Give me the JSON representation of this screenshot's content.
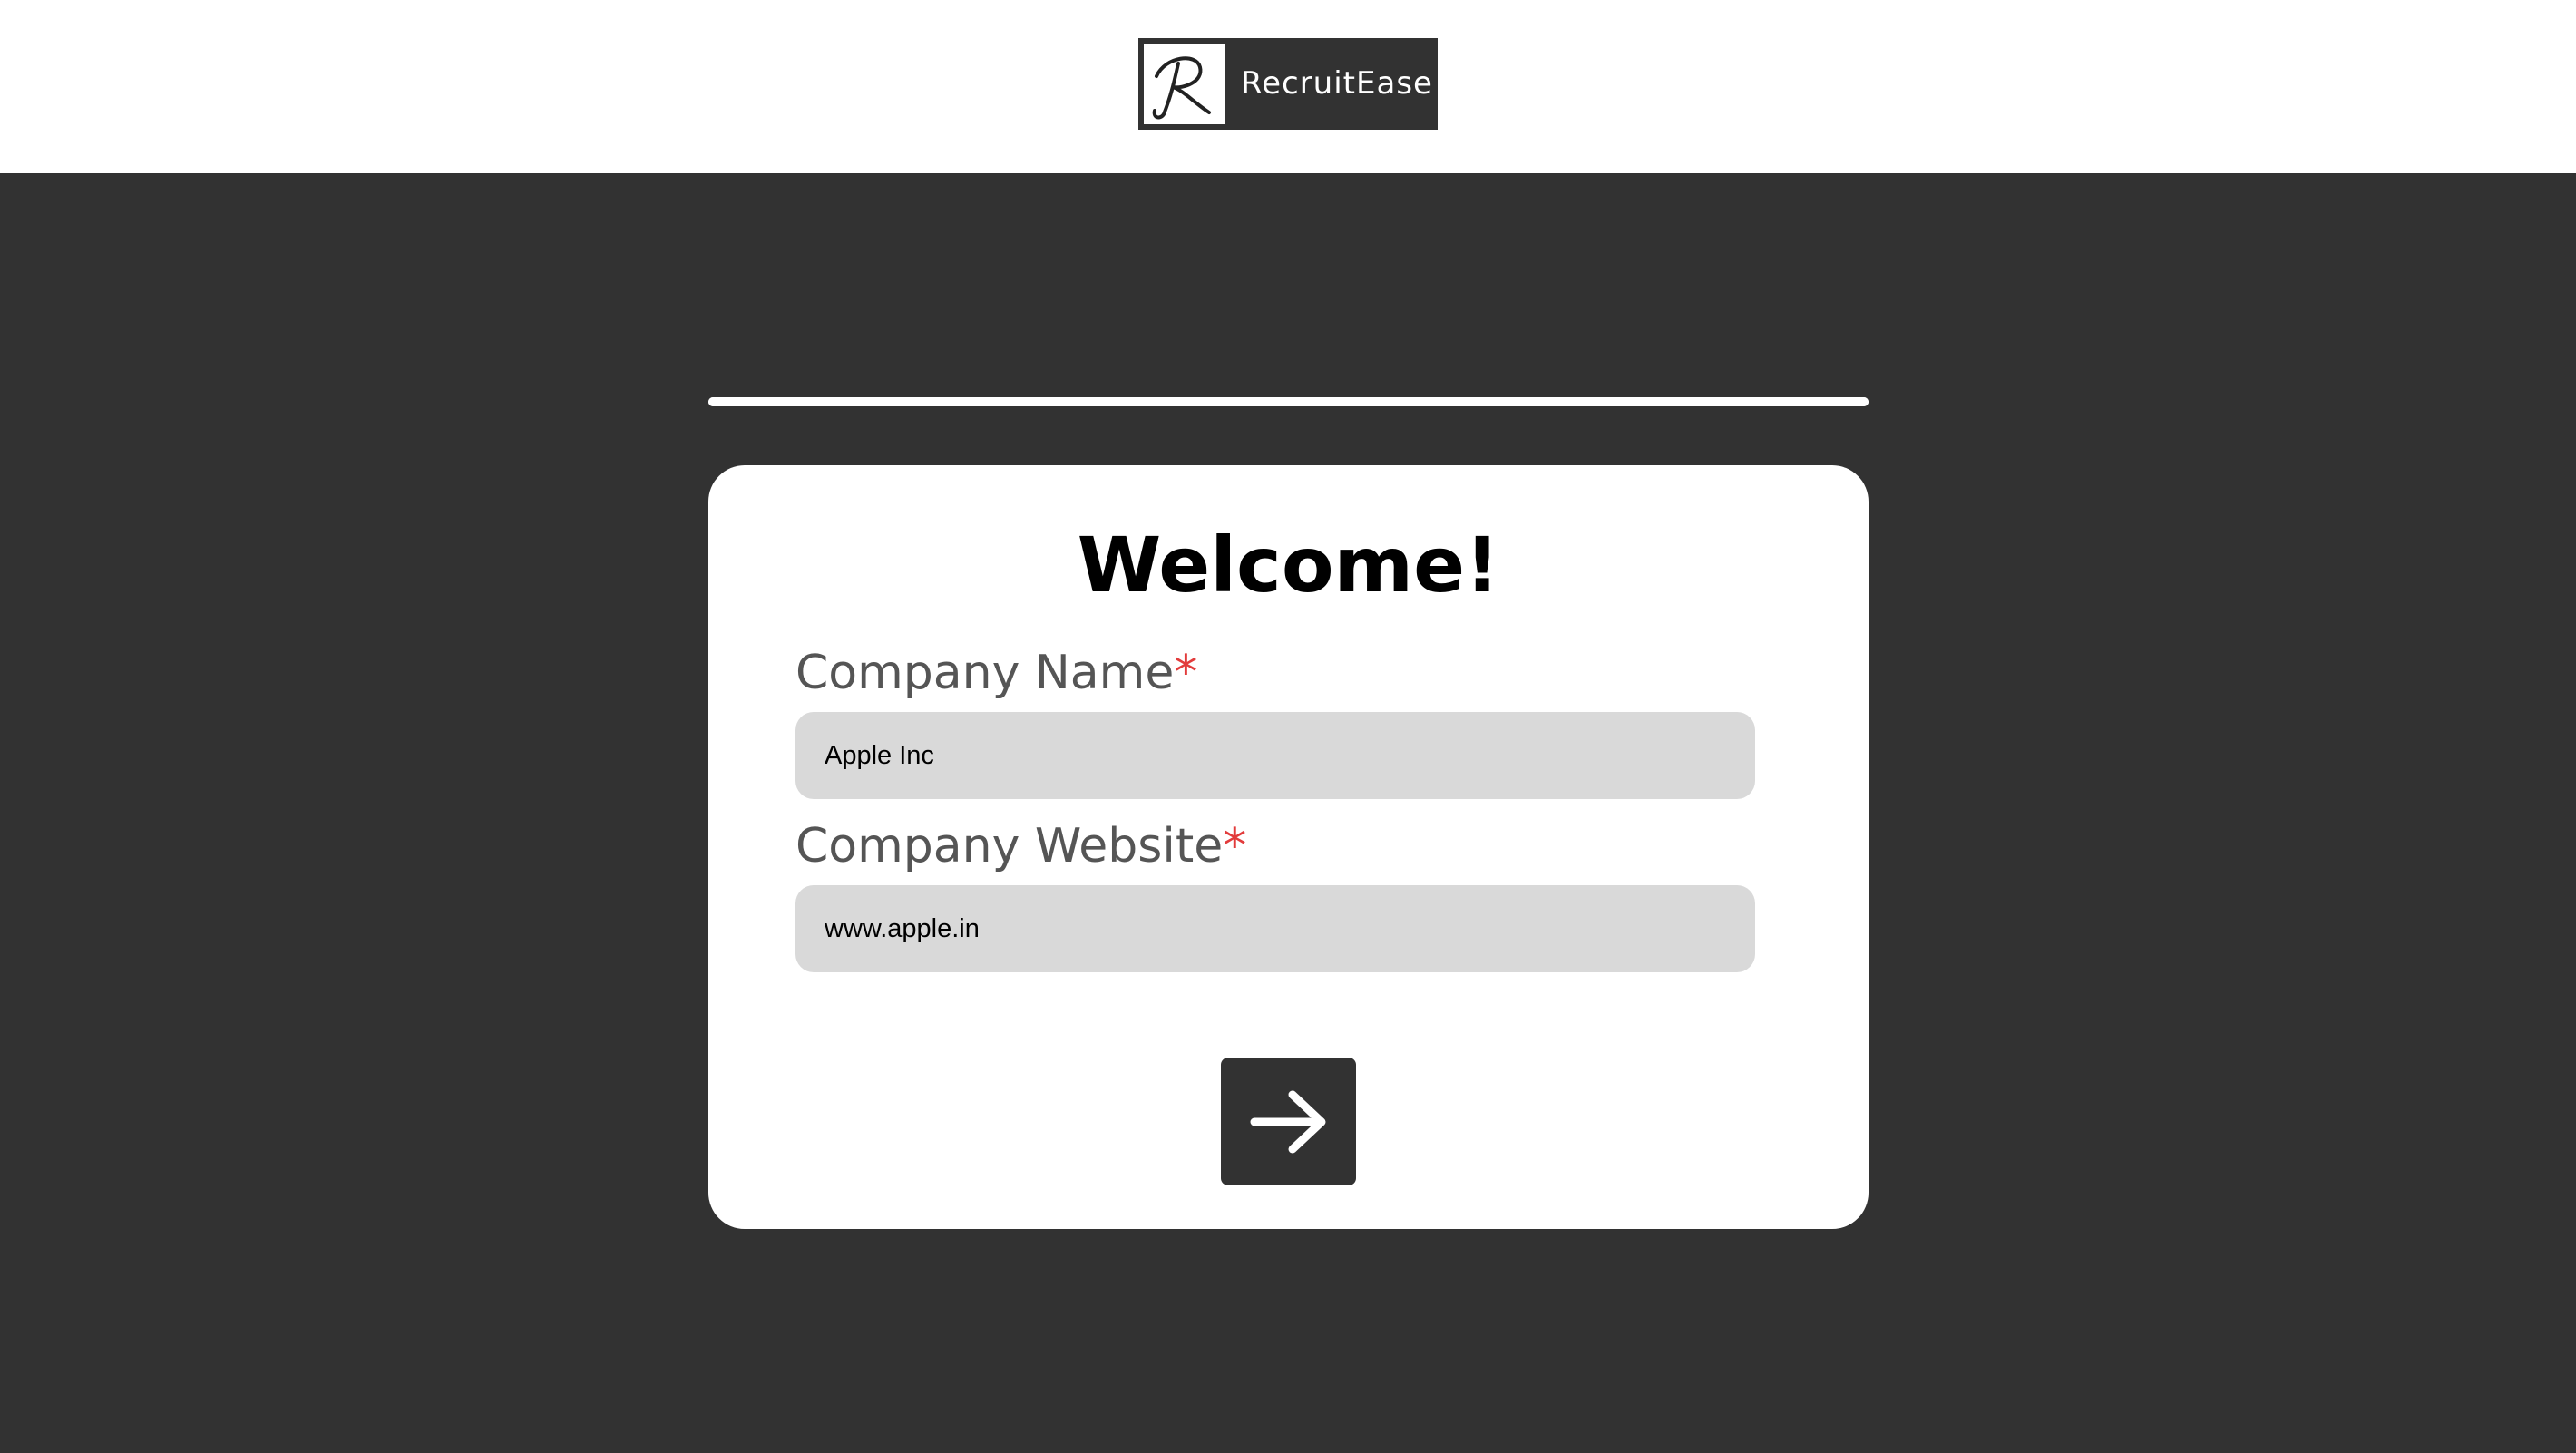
{
  "header": {
    "brand_name": "RecruitEase",
    "logo_icon": "script-r-logo"
  },
  "progress": {
    "fraction": 1.0
  },
  "form": {
    "title": "Welcome!",
    "required_marker": "*",
    "fields": [
      {
        "label": "Company Name",
        "value": "Apple Inc"
      },
      {
        "label": "Company Website",
        "value": "www.apple.in"
      }
    ],
    "next_button_icon": "arrow-right-icon"
  },
  "colors": {
    "background": "#323232",
    "card": "#ffffff",
    "input_background": "#d9d9d9",
    "label_text": "#555555",
    "required": "#e23b3b"
  }
}
